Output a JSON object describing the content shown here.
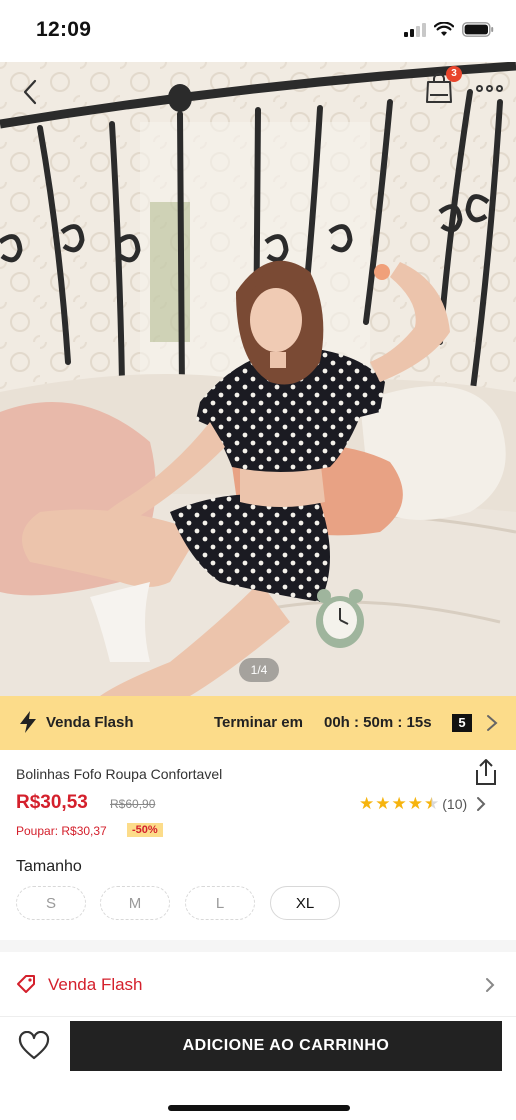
{
  "status_bar": {
    "time": "12:09"
  },
  "hero": {
    "cart_count": "3",
    "pager": "1/4"
  },
  "flash_bar": {
    "label": "Venda Flash",
    "ends_label": "Terminar em",
    "countdown": "00h : 50m : 15s",
    "countdown_box": "5"
  },
  "product": {
    "title": "Bolinhas Fofo Roupa Confortavel",
    "price": "R$30,53",
    "old_price": "R$60,90",
    "rating_stars": 4.5,
    "rating_count": "(10)",
    "save_text": "Poupar: R$30,37",
    "discount": "-50%"
  },
  "sizes": {
    "title": "Tamanho",
    "options": [
      {
        "label": "S",
        "available": false
      },
      {
        "label": "M",
        "available": false
      },
      {
        "label": "L",
        "available": false
      },
      {
        "label": "XL",
        "available": true
      }
    ]
  },
  "flash_row": {
    "label": "Venda Flash"
  },
  "bottom_bar": {
    "add_to_cart": "ADICIONE AO CARRINHO"
  },
  "colors": {
    "price_red": "#d4202c",
    "flash_yellow": "#fcdc8a",
    "button_dark": "#222222",
    "star_gold": "#f6b40e"
  },
  "icons": [
    "back-icon",
    "bag-icon",
    "more-icon",
    "bolt-icon",
    "chevron-right-icon",
    "share-icon",
    "star-icon",
    "tag-icon",
    "heart-icon",
    "signal-icon",
    "wifi-icon",
    "battery-icon"
  ]
}
